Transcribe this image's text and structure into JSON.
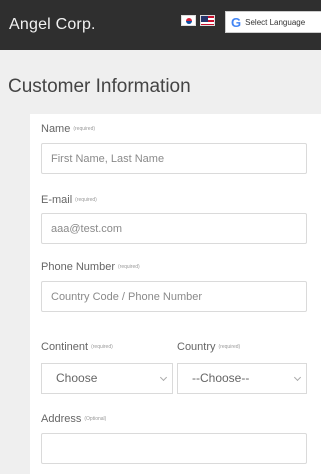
{
  "header": {
    "brand": "Angel Corp.",
    "translate_label": "Select Language",
    "translate_logo": "G",
    "flags": [
      "korea-flag-icon",
      "usa-flag-icon"
    ]
  },
  "title": "Customer Information",
  "form": {
    "name": {
      "label": "Name",
      "required": "(required)",
      "placeholder": "First Name, Last Name"
    },
    "email": {
      "label": "E-mail",
      "required": "(required)",
      "placeholder": "aaa@test.com"
    },
    "phone": {
      "label": "Phone Number",
      "required": "(required)",
      "placeholder": "Country Code / Phone Number"
    },
    "continent": {
      "label": "Continent",
      "required": "(required)",
      "value": "Choose"
    },
    "country": {
      "label": "Country",
      "required": "(required)",
      "value": "--Choose--"
    },
    "address": {
      "label": "Address",
      "optional": "(Optional)",
      "value": ""
    }
  },
  "colors": {
    "topbar": "#2f2f2f",
    "page_bg": "#efefef",
    "card_bg": "#ffffff"
  }
}
